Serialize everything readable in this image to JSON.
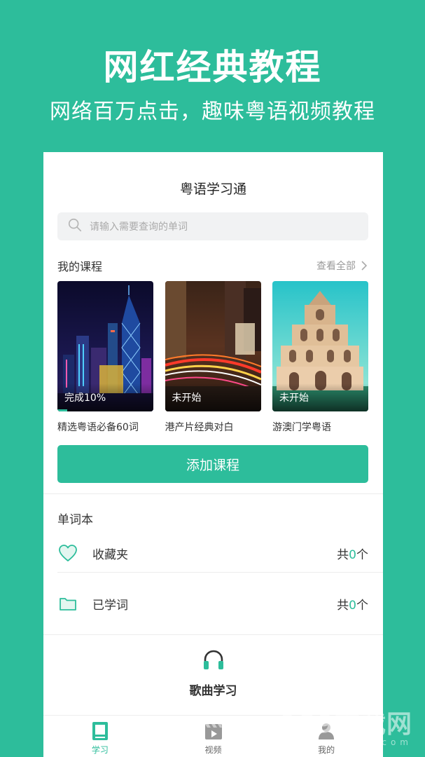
{
  "promo": {
    "title": "网红经典教程",
    "subtitle": "网络百万点击，趣味粤语视频教程"
  },
  "app": {
    "title": "粤语学习通",
    "search_placeholder": "请输入需要查询的单词"
  },
  "my_courses": {
    "title": "我的课程",
    "view_all": "查看全部",
    "items": [
      {
        "status": "完成10%",
        "name": "精选粤语必备60词",
        "progress": 0.1,
        "image": "hong-kong-night-skyline"
      },
      {
        "status": "未开始",
        "name": "港产片经典对白",
        "progress": 0,
        "image": "city-light-trails"
      },
      {
        "status": "未开始",
        "name": "游澳门学粤语",
        "progress": 0,
        "image": "macau-st-paul-ruins"
      }
    ]
  },
  "add_course_label": "添加课程",
  "wordbook": {
    "title": "单词本",
    "rows": [
      {
        "icon": "heart-icon",
        "label": "收藏夹",
        "prefix": "共",
        "count": "0",
        "suffix": "个"
      },
      {
        "icon": "folder-icon",
        "label": "已学词",
        "prefix": "共",
        "count": "0",
        "suffix": "个"
      }
    ]
  },
  "song": {
    "icon": "headphones-icon",
    "label": "歌曲学习"
  },
  "tabs": [
    {
      "label": "学习",
      "icon": "study-icon",
      "active": true
    },
    {
      "label": "视频",
      "icon": "video-icon",
      "active": false
    },
    {
      "label": "我的",
      "icon": "profile-icon",
      "active": false
    }
  ],
  "watermark": {
    "main": "189下载网",
    "sub": "www.189d.com"
  },
  "colors": {
    "accent": "#2dbd9b"
  }
}
